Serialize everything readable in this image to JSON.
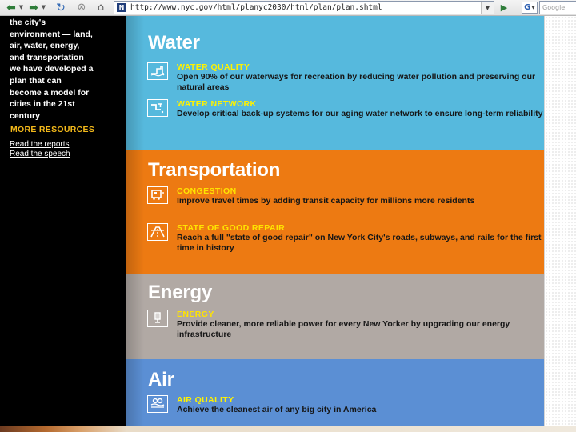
{
  "browser": {
    "url": "http://www.nyc.gov/html/planyc2030/html/plan/plan.shtml",
    "favicon_text": "N",
    "search_engine_label": "G",
    "search_placeholder": "Google",
    "icons": {
      "back": "back-arrow-icon",
      "forward": "forward-arrow-icon",
      "reload": "reload-icon",
      "stop": "stop-icon",
      "home": "home-icon",
      "go": "go-arrow-icon"
    }
  },
  "sidebar": {
    "lines": [
      "the city's",
      "environment — land,",
      "air, water, energy,",
      "and transportation —",
      "we have developed a",
      "plan that can",
      "become a model for",
      "cities in the 21st",
      "century"
    ],
    "more_resources": "MORE RESOURCES",
    "links": [
      "Read the reports",
      "Read the speech"
    ]
  },
  "sections": {
    "water": {
      "heading": "Water",
      "color": "#56b9dd",
      "items": [
        {
          "title": "WATER QUALITY",
          "desc": "Open 90% of our waterways for recreation by reducing water pollution and preserving our natural areas",
          "icon": "water-quality-icon"
        },
        {
          "title": "WATER NETWORK",
          "desc": "Develop critical back-up systems for our aging water network to ensure long-term reliability",
          "icon": "water-network-icon"
        }
      ]
    },
    "transportation": {
      "heading": "Transportation",
      "color": "#ed7a12",
      "items": [
        {
          "title": "CONGESTION",
          "desc": "Improve travel times by adding transit capacity for millions more residents",
          "icon": "congestion-icon"
        },
        {
          "title": "STATE OF GOOD REPAIR",
          "desc": "Reach a full \"state of good repair\" on New York City's roads, subways, and rails for the first time in history",
          "icon": "good-repair-icon"
        }
      ]
    },
    "energy": {
      "heading": "Energy",
      "color": "#b1a9a4",
      "items": [
        {
          "title": "ENERGY",
          "desc": "Provide cleaner, more reliable power for every New Yorker by upgrading our energy infrastructure",
          "icon": "energy-icon"
        }
      ]
    },
    "air": {
      "heading": "Air",
      "color": "#5b8fd4",
      "items": [
        {
          "title": "AIR QUALITY",
          "desc": "Achieve the cleanest air of any big city in America",
          "icon": "air-quality-icon"
        }
      ]
    }
  }
}
